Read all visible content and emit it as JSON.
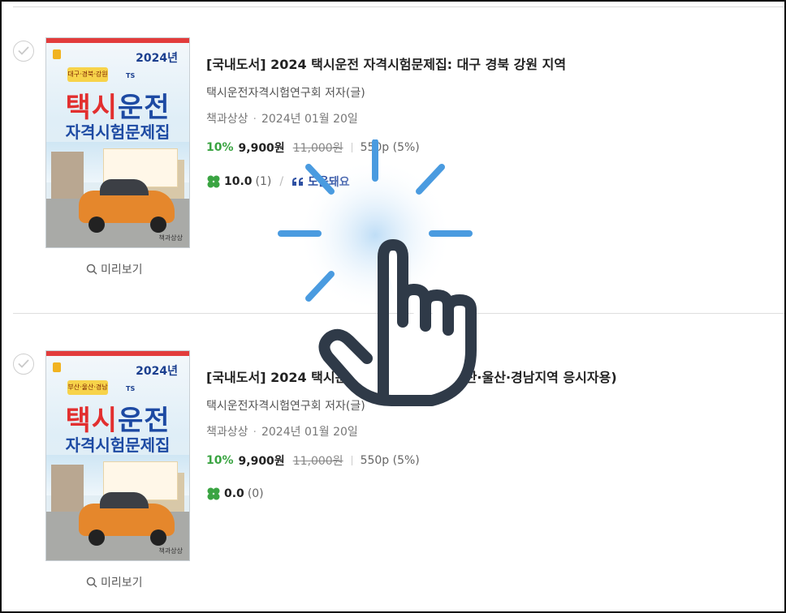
{
  "items": [
    {
      "preview_label": "미리보기",
      "title": "[국내도서] 2024 택시운전 자격시험문제집: 대구 경북 강원 지역",
      "author": "택시운전자격시험연구회 저자(글)",
      "publisher": "책과상상",
      "date": "2024년 01월 20일",
      "discount": "10%",
      "sale_price": "9,900원",
      "original_price": "11,000원",
      "points": "550p (5%)",
      "rating": "10.0",
      "review_count": "(1)",
      "review_label": "도움돼요",
      "cover": {
        "year": "2024년",
        "badge": "대구·경북·강원",
        "title_red": "택시",
        "title_blue": "운전",
        "subtitle": "자격시험문제집",
        "brand": "TS",
        "publisher": "책과상상"
      }
    },
    {
      "preview_label": "미리보기",
      "title": "[국내도서] 2024 택시운전 자격시험문제집(부산·울산·경남지역 응시자용)",
      "author": "택시운전자격시험연구회 저자(글)",
      "publisher": "책과상상",
      "date": "2024년 01월 20일",
      "discount": "10%",
      "sale_price": "9,900원",
      "original_price": "11,000원",
      "points": "550p (5%)",
      "rating": "0.0",
      "review_count": "(0)",
      "cover": {
        "year": "2024년",
        "badge": "부산·울산·경남",
        "title_red": "택시",
        "title_blue": "운전",
        "subtitle": "자격시험문제집",
        "brand": "TS",
        "publisher": "책과상상"
      }
    }
  ],
  "colors": {
    "discount": "#3aa442",
    "review": "#2d4fa2",
    "clover": "#3aa442",
    "tap_hand": "#2f3a48",
    "tap_rays": "#4a9be0"
  }
}
